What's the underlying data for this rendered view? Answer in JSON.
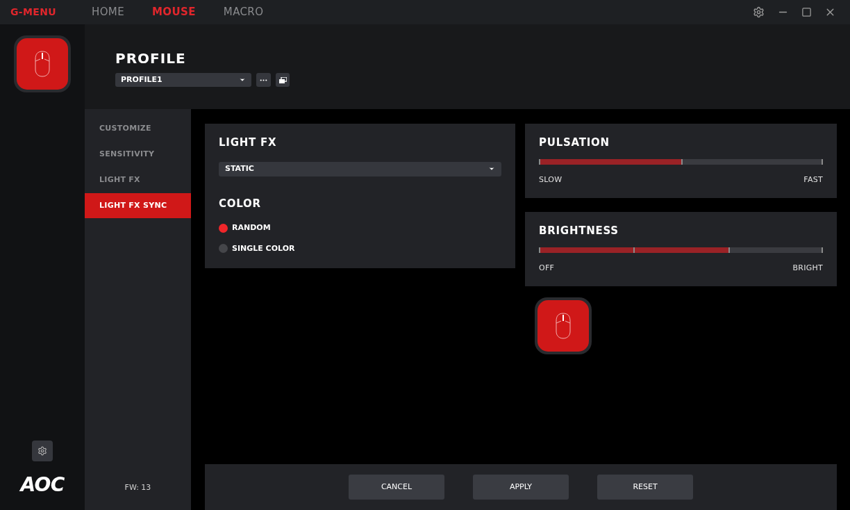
{
  "app_title": "G-MENU",
  "nav": [
    {
      "label": "HOME",
      "selected": false
    },
    {
      "label": "MOUSE",
      "selected": true
    },
    {
      "label": "MACRO",
      "selected": false
    }
  ],
  "logo": "AOC",
  "profile": {
    "title": "PROFILE",
    "value": "PROFILE1"
  },
  "submenu": [
    {
      "label": "CUSTOMIZE",
      "selected": false
    },
    {
      "label": "SENSITIVITY",
      "selected": false
    },
    {
      "label": "LIGHT FX",
      "selected": false
    },
    {
      "label": "LIGHT FX SYNC",
      "selected": true
    }
  ],
  "firmware": "FW: 13",
  "light_fx": {
    "title": "LIGHT FX",
    "value": "STATIC"
  },
  "color": {
    "title": "COLOR",
    "options": [
      {
        "label": "RANDOM",
        "selected": true
      },
      {
        "label": "SINGLE COLOR",
        "selected": false
      }
    ]
  },
  "sliders": [
    {
      "kind": "continuous",
      "title": "PULSATION",
      "level": 0.5,
      "min_label": "SLOW",
      "max_label": "FAST"
    },
    {
      "kind": "stepped",
      "title": "BRIGHTNESS",
      "level": 0.667,
      "min_label": "OFF",
      "max_label": "BRIGHT"
    }
  ],
  "buttons": [
    "CANCEL",
    "APPLY",
    "RESET"
  ]
}
